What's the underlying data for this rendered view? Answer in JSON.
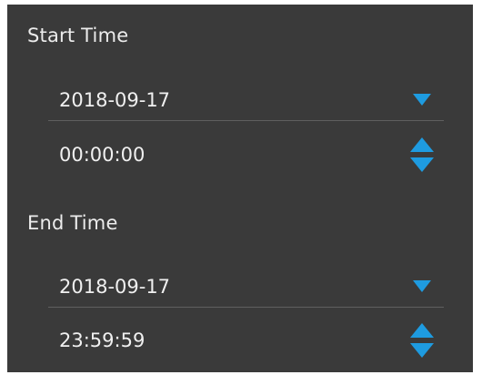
{
  "start_time": {
    "label": "Start Time",
    "date": "2018-09-17",
    "time": "00:00:00"
  },
  "end_time": {
    "label": "End Time",
    "date": "2018-09-17",
    "time": "23:59:59"
  },
  "icons": {
    "date_dropdown": "chevron-down-triangle",
    "time_spinner": "up-down-triangles"
  },
  "colors": {
    "panel_background": "#3a3a3a",
    "accent": "#1e9be0",
    "text": "#f0f0f0",
    "divider": "#5f5f5f"
  }
}
